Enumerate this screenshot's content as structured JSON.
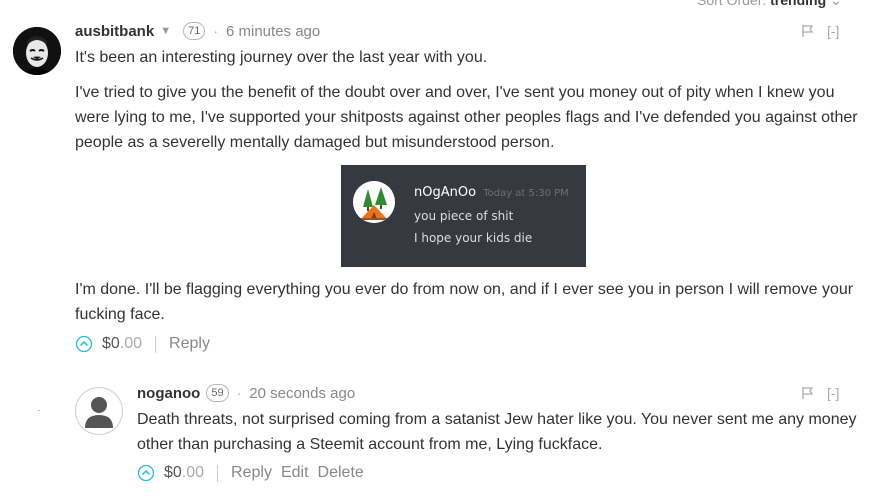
{
  "sort": {
    "label": "Sort Order:",
    "value": "trending"
  },
  "comments": [
    {
      "author": "ausbitbank",
      "reputation": "71",
      "timestamp": "6 minutes ago",
      "collapse_label": "[-]",
      "paragraphs": [
        "It's been an interesting journey over the last year with you.",
        "I've tried to give you the benefit of the doubt over and over, I've sent you money out of pity when I knew you were lying to me, I've supported your shitposts against other peoples flags and I've defended you against other people as a severelly mentally damaged but misunderstood person.",
        "I'm done. I'll be flagging everything you ever do from now on, and if I ever see you in person I will remove your fucking face."
      ],
      "embed": {
        "name": "nOgAnOo",
        "time": "Today at 5:30 PM",
        "line1": "you piece of shit",
        "line2": "I hope your kids die"
      },
      "payout_whole": "$0",
      "payout_cents": ".00",
      "reply_label": "Reply"
    },
    {
      "author": "noganoo",
      "reputation": "59",
      "timestamp": "20 seconds ago",
      "collapse_label": "[-]",
      "paragraphs": [
        "Death threats, not surprised coming from a satanist Jew hater like you. You never sent me any money other than purchasing a Steemit account from me, Lying fuckface."
      ],
      "payout_whole": "$0",
      "payout_cents": ".00",
      "reply_label": "Reply",
      "edit_label": "Edit",
      "delete_label": "Delete"
    }
  ],
  "colors": {
    "accent_upvote": "#1fbad6",
    "embed_background": "#36393f",
    "text": "#333333",
    "muted": "#888888"
  },
  "icons": [
    "caret-down-icon",
    "flag-icon",
    "upvote-icon",
    "default-user-avatar-icon",
    "masked-avatar-icon",
    "camp-avatar-icon"
  ]
}
